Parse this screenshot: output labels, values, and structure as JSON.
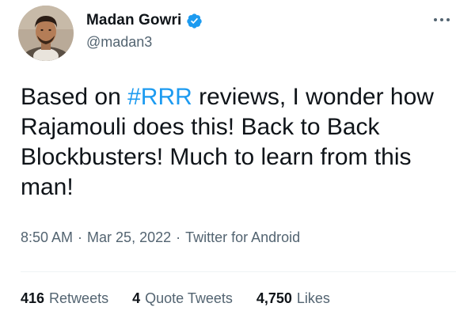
{
  "user": {
    "display_name": "Madan Gowri",
    "handle": "@madan3",
    "avatar_icon": "profile-photo",
    "verified_icon": "verified-badge-icon"
  },
  "tweet": {
    "text_before": "Based on ",
    "hashtag": "#RRR",
    "text_after": " reviews, I wonder how Rajamouli does this! Back to Back Blockbusters! Much to learn from this man!",
    "time": "8:50 AM",
    "separator": "·",
    "date": "Mar 25, 2022",
    "source": "Twitter for Android"
  },
  "stats": {
    "retweets_count": "416",
    "retweets_label": "Retweets",
    "quotes_count": "4",
    "quotes_label": "Quote Tweets",
    "likes_count": "4,750",
    "likes_label": "Likes"
  },
  "colors": {
    "accent": "#1d9bf0",
    "text": "#0f1419",
    "muted": "#536471",
    "divider": "#eff3f4"
  }
}
